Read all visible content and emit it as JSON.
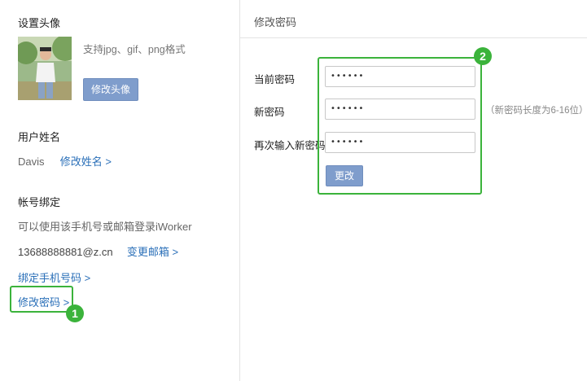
{
  "left": {
    "avatar_section": {
      "title": "设置头像",
      "hint": "支持jpg、gif、png格式",
      "change_button": "修改头像"
    },
    "name_section": {
      "title": "用户姓名",
      "name": "Davis",
      "edit_link": "修改姓名 >"
    },
    "account_section": {
      "title": "帐号绑定",
      "description": "可以使用该手机号或邮箱登录iWorker",
      "email": "13688888881@z.cn",
      "change_email_link": "变更邮箱 >",
      "bind_phone_link": "绑定手机号码 >",
      "change_password_link": "修改密码 >"
    }
  },
  "right": {
    "title": "修改密码",
    "fields": [
      {
        "label": "当前密码",
        "value": "••••••"
      },
      {
        "label": "新密码",
        "value": "••••••"
      },
      {
        "label": "再次输入新密码",
        "value": "••••••"
      }
    ],
    "new_password_note": "（新密码长度为6-16位）",
    "submit_button": "更改"
  },
  "annotations": {
    "step1": "1",
    "step2": "2",
    "color": "#3bb33b"
  },
  "colors": {
    "button": "#7f9dcc",
    "link": "#2a6fb8"
  }
}
